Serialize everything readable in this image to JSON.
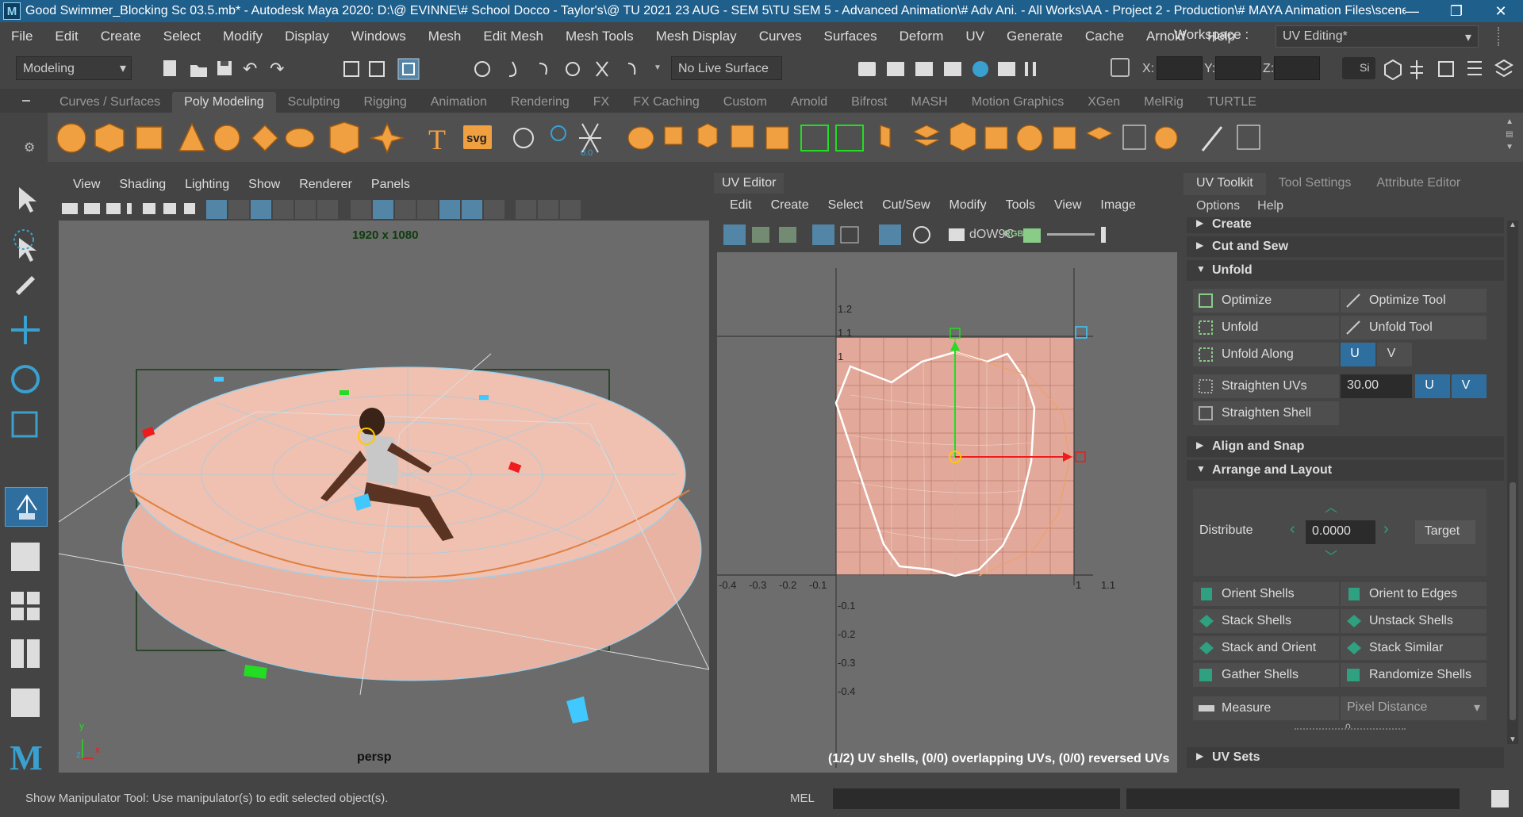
{
  "titlebar": {
    "title": "Good Swimmer_Blocking Sc 03.5.mb* - Autodesk Maya 2020: D:\\@ EVINNE\\# School Docco - Taylor's\\@ TU 2021 23 AUG - SEM 5\\TU SEM 5 - Advanced Animation\\# Adv Ani. - All Works\\AA - Project 2 - Production\\# MAYA Animation Files\\scenes\\Good Swi...",
    "logo": "M",
    "minimize": "—",
    "maximize": "❐",
    "close": "✕"
  },
  "menubar": {
    "items": [
      "File",
      "Edit",
      "Create",
      "Select",
      "Modify",
      "Display",
      "Windows",
      "Mesh",
      "Edit Mesh",
      "Mesh Tools",
      "Mesh Display",
      "Curves",
      "Surfaces",
      "Deform",
      "UV",
      "Generate",
      "Cache",
      "Arnold",
      "Help"
    ],
    "workspace_label": "Workspace :",
    "workspace_value": "UV Editing*"
  },
  "statusline": {
    "menuset": "Modeling",
    "live_surface": "No Live Surface",
    "x_label": "X:",
    "y_label": "Y:",
    "z_label": "Z:",
    "sign_in": "Si"
  },
  "shelf": {
    "tabs": [
      "Curves / Surfaces",
      "Poly Modeling",
      "Sculpting",
      "Rigging",
      "Animation",
      "Rendering",
      "FX",
      "FX Caching",
      "Custom",
      "Arnold",
      "Bifrost",
      "MASH",
      "Motion Graphics",
      "XGen",
      "MelRig",
      "TURTLE"
    ],
    "active_tab": "Poly Modeling",
    "text_tool": "T",
    "svg_tool": "svg",
    "counter": "0.0"
  },
  "viewport": {
    "menu": [
      "View",
      "Shading",
      "Lighting",
      "Show",
      "Renderer",
      "Panels"
    ],
    "resolution": "1920 x 1080",
    "camera": "persp",
    "axis_y": "y",
    "axis_x": "x",
    "axis_z": "z"
  },
  "uv_editor": {
    "title": "UV Editor",
    "menu": [
      "Edit",
      "Create",
      "Select",
      "Cut/Sew",
      "Modify",
      "Tools",
      "View",
      "Image"
    ],
    "image_name": "dOW9C",
    "rgb": "RGB",
    "info": "(1/2) UV shells, (0/0) overlapping UVs, (0/0) reversed UVs",
    "x_ticks": [
      "-0.4",
      "-0.3",
      "-0.2",
      "-0.1",
      "1",
      "1.1"
    ],
    "y_ticks": [
      "1.2",
      "1.1",
      "1",
      "-0.1",
      "-0.2",
      "-0.3",
      "-0.4"
    ]
  },
  "uv_toolkit": {
    "tabs": [
      "UV Toolkit",
      "Tool Settings",
      "Attribute Editor"
    ],
    "menu": [
      "Options",
      "Help"
    ],
    "sections": {
      "create": "Create",
      "cut_and_sew": "Cut and Sew",
      "unfold": "Unfold",
      "align_and_snap": "Align and Snap",
      "arrange_and_layout": "Arrange and Layout",
      "uv_sets": "UV Sets"
    },
    "unfold": {
      "optimize": "Optimize",
      "optimize_tool": "Optimize Tool",
      "unfold": "Unfold",
      "unfold_tool": "Unfold Tool",
      "unfold_along": "Unfold Along",
      "u": "U",
      "v": "V",
      "straighten_uvs": "Straighten UVs",
      "straighten_value": "30.00",
      "straighten_shell": "Straighten Shell"
    },
    "arrange": {
      "distribute": "Distribute",
      "distribute_value": "0.0000",
      "target": "Target",
      "orient_shells": "Orient Shells",
      "orient_to_edges": "Orient to Edges",
      "stack_shells": "Stack Shells",
      "unstack_shells": "Unstack Shells",
      "stack_and_orient": "Stack and Orient",
      "stack_similar": "Stack Similar",
      "gather_shells": "Gather Shells",
      "randomize_shells": "Randomize Shells",
      "measure": "Measure",
      "pixel_distance": "Pixel Distance",
      "measure_value": "0"
    }
  },
  "bottom": {
    "help_text": "Show Manipulator Tool: Use manipulator(s) to edit selected object(s).",
    "mel": "MEL"
  },
  "colors": {
    "titlebar": "#1f5f8b",
    "accent_blue": "#2f6f9f",
    "shelf_orange": "#f0a040",
    "bowl_pink": "#e8b0a0",
    "manip_green": "#22dd22",
    "manip_red": "#ff2020",
    "uv_white": "#ffffff"
  }
}
